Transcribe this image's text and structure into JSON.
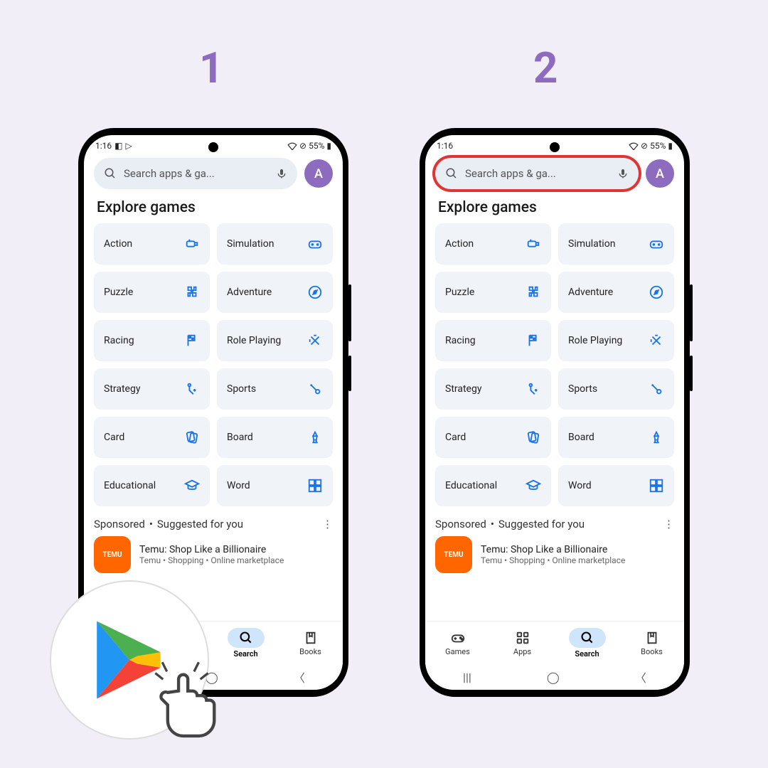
{
  "steps": [
    "1",
    "2"
  ],
  "status": {
    "time": "1:16",
    "battery": "55%"
  },
  "search": {
    "placeholder": "Search apps & ga..."
  },
  "avatar_letter": "A",
  "title": "Explore games",
  "chips": [
    {
      "label": "Action",
      "icon": "action"
    },
    {
      "label": "Simulation",
      "icon": "simulation"
    },
    {
      "label": "Puzzle",
      "icon": "puzzle"
    },
    {
      "label": "Adventure",
      "icon": "adventure"
    },
    {
      "label": "Racing",
      "icon": "racing"
    },
    {
      "label": "Role Playing",
      "icon": "roleplaying"
    },
    {
      "label": "Strategy",
      "icon": "strategy"
    },
    {
      "label": "Sports",
      "icon": "sports"
    },
    {
      "label": "Card",
      "icon": "card"
    },
    {
      "label": "Board",
      "icon": "board"
    },
    {
      "label": "Educational",
      "icon": "educational"
    },
    {
      "label": "Word",
      "icon": "word"
    }
  ],
  "sponsored_label": "Sponsored",
  "suggested_label": "Suggested for you",
  "app": {
    "name": "TEMU",
    "title": "Temu: Shop Like a Billionaire",
    "meta": "Temu • Shopping • Online marketplace"
  },
  "nav": [
    {
      "label": "Games",
      "icon": "games"
    },
    {
      "label": "Apps",
      "icon": "apps"
    },
    {
      "label": "Search",
      "icon": "search",
      "active": true
    },
    {
      "label": "Books",
      "icon": "books"
    }
  ]
}
